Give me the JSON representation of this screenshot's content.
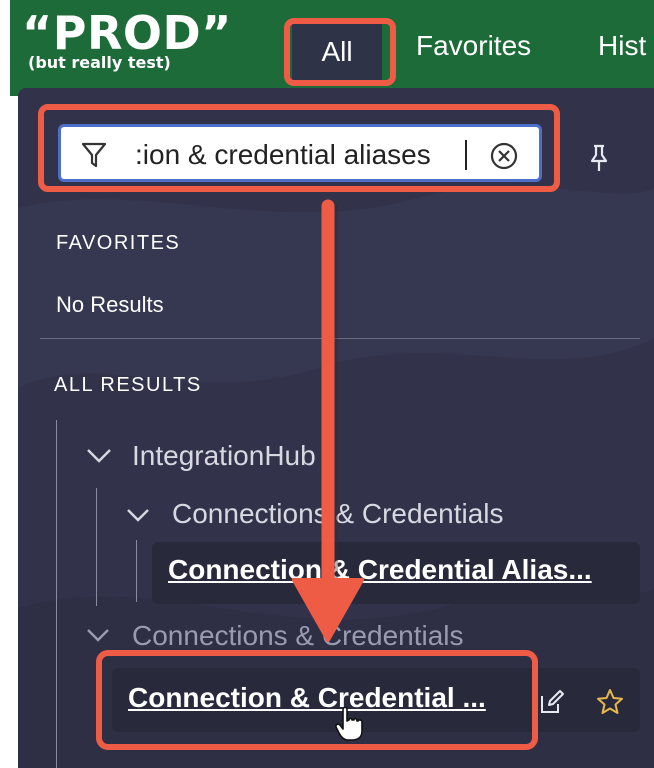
{
  "header": {
    "logo_main": "“PROD”",
    "logo_sub": "(but really test)",
    "tabs": [
      {
        "label": "All"
      },
      {
        "label": "Favorites"
      },
      {
        "label": "Hist"
      }
    ]
  },
  "search": {
    "value": ":ion & credential aliases",
    "filter_icon": "filter-icon",
    "clear_icon": "clear-circle-x-icon"
  },
  "pin_icon": "pin-icon",
  "favorites": {
    "label": "FAVORITES",
    "empty": "No Results"
  },
  "all_results": {
    "label": "ALL RESULTS",
    "tree": [
      {
        "label": "IntegrationHub",
        "children": [
          {
            "label": "Connections & Credentials",
            "children": [
              {
                "label": "Connection & Credential Alias..."
              }
            ]
          }
        ]
      },
      {
        "label": "Connections & Credentials",
        "children": [
          {
            "label": "Connection & Credential ...",
            "actions": [
              "edit-icon",
              "star-icon"
            ]
          }
        ]
      }
    ]
  },
  "colors": {
    "header_bg": "#1e6b3a",
    "panel_bg": "#32334a",
    "highlight": "#ef5c45",
    "star": "#e8b84a"
  }
}
